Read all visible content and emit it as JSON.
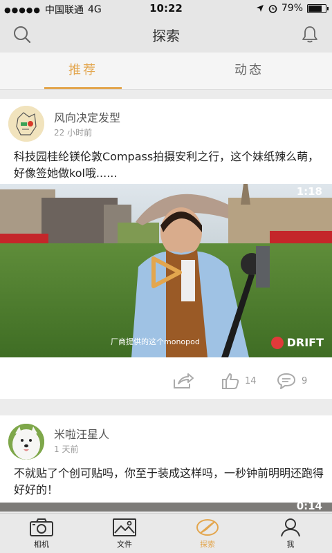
{
  "status_bar": {
    "carrier": "中国联通",
    "network": "4G",
    "time": "10:22",
    "battery": "79%",
    "battery_level": 0.79
  },
  "nav": {
    "title": "探索"
  },
  "tabs": [
    {
      "label": "推荐"
    },
    {
      "label": "动态"
    }
  ],
  "posts": [
    {
      "author": "风向决定发型",
      "time": "22 小时前",
      "text": "科技园桂纶镁伦敦Compass拍摄安利之行，这个妹纸辣么萌，好像签她做kol哦......",
      "video_duration": "1:18",
      "video_caption": "厂商提供的这个monopod",
      "video_brand": "DRIFT",
      "likes": "14",
      "comments": "9"
    },
    {
      "author": "米啦汪星人",
      "time": "1 天前",
      "text": "不就贴了个创可贴吗，你至于装成这样吗，一秒钟前明明还跑得好好的！",
      "video_duration": "0:14"
    }
  ],
  "tabbar": [
    {
      "label": "相机",
      "icon": "camera-icon"
    },
    {
      "label": "文件",
      "icon": "image-icon"
    },
    {
      "label": "探索",
      "icon": "compass-icon"
    },
    {
      "label": "我",
      "icon": "person-icon"
    }
  ],
  "colors": {
    "accent": "#e3a64e",
    "drift_red": "#e03a3a",
    "bar_bg": "#e6e6e6"
  }
}
